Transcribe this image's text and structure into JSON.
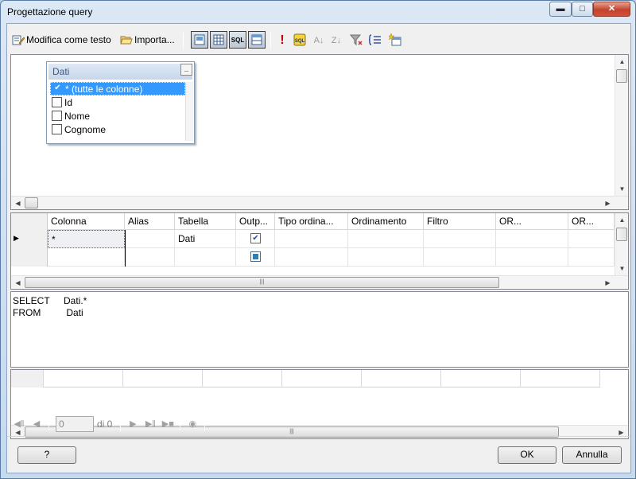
{
  "window": {
    "title": "Progettazione query"
  },
  "toolbar": {
    "edit_as_text": "Modifica come testo",
    "import": "Importa...",
    "sql_label": "SQL"
  },
  "diagram": {
    "table": {
      "title": "Dati",
      "columns": [
        {
          "label": "* (tutte le colonne)",
          "checked": true,
          "selected": true
        },
        {
          "label": "Id",
          "checked": false
        },
        {
          "label": "Nome",
          "checked": false
        },
        {
          "label": "Cognome",
          "checked": false
        }
      ]
    }
  },
  "grid": {
    "headers": [
      "Colonna",
      "Alias",
      "Tabella",
      "Outp...",
      "Tipo ordina...",
      "Ordinamento",
      "Filtro",
      "OR...",
      "OR..."
    ],
    "rows": [
      {
        "colonna": "*",
        "alias": "",
        "tabella": "Dati",
        "output": true
      },
      {
        "colonna": "",
        "alias": "",
        "tabella": "",
        "output": true
      }
    ]
  },
  "sql": {
    "lines": [
      {
        "keyword": "SELECT",
        "value": "Dati.*"
      },
      {
        "keyword": "FROM",
        "value": " Dati"
      }
    ]
  },
  "navigator": {
    "position_value": "0",
    "of_label": "di 0"
  },
  "buttons": {
    "help": "?",
    "ok": "OK",
    "cancel": "Annulla"
  }
}
